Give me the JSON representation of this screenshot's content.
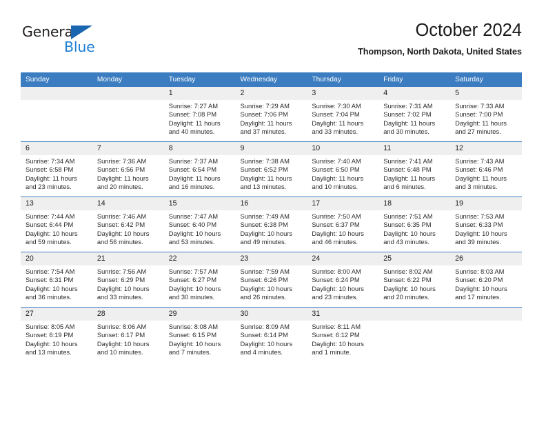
{
  "brand": {
    "name_top": "General",
    "name_bottom": "Blue",
    "accent_color": "#1f7fd4",
    "triangle_color": "#1b66b0"
  },
  "header": {
    "title": "October 2024",
    "location": "Thompson, North Dakota, United States"
  },
  "theme": {
    "header_row_bg": "#3b7dc0",
    "daynum_bg": "#efefef",
    "rule_color": "#3b7dc0",
    "text_color": "#2b2b2b"
  },
  "calendar": {
    "weekday_headers": [
      "Sunday",
      "Monday",
      "Tuesday",
      "Wednesday",
      "Thursday",
      "Friday",
      "Saturday"
    ],
    "labels": {
      "sunrise": "Sunrise:",
      "sunset": "Sunset:",
      "daylight": "Daylight:"
    },
    "weeks": [
      [
        {
          "day": "",
          "sunrise": "",
          "sunset": "",
          "daylight_1": "",
          "daylight_2": "",
          "empty": true
        },
        {
          "day": "",
          "sunrise": "",
          "sunset": "",
          "daylight_1": "",
          "daylight_2": "",
          "empty": true
        },
        {
          "day": "1",
          "sunrise": "Sunrise: 7:27 AM",
          "sunset": "Sunset: 7:08 PM",
          "daylight_1": "Daylight: 11 hours",
          "daylight_2": "and 40 minutes."
        },
        {
          "day": "2",
          "sunrise": "Sunrise: 7:29 AM",
          "sunset": "Sunset: 7:06 PM",
          "daylight_1": "Daylight: 11 hours",
          "daylight_2": "and 37 minutes."
        },
        {
          "day": "3",
          "sunrise": "Sunrise: 7:30 AM",
          "sunset": "Sunset: 7:04 PM",
          "daylight_1": "Daylight: 11 hours",
          "daylight_2": "and 33 minutes."
        },
        {
          "day": "4",
          "sunrise": "Sunrise: 7:31 AM",
          "sunset": "Sunset: 7:02 PM",
          "daylight_1": "Daylight: 11 hours",
          "daylight_2": "and 30 minutes."
        },
        {
          "day": "5",
          "sunrise": "Sunrise: 7:33 AM",
          "sunset": "Sunset: 7:00 PM",
          "daylight_1": "Daylight: 11 hours",
          "daylight_2": "and 27 minutes."
        }
      ],
      [
        {
          "day": "6",
          "sunrise": "Sunrise: 7:34 AM",
          "sunset": "Sunset: 6:58 PM",
          "daylight_1": "Daylight: 11 hours",
          "daylight_2": "and 23 minutes."
        },
        {
          "day": "7",
          "sunrise": "Sunrise: 7:36 AM",
          "sunset": "Sunset: 6:56 PM",
          "daylight_1": "Daylight: 11 hours",
          "daylight_2": "and 20 minutes."
        },
        {
          "day": "8",
          "sunrise": "Sunrise: 7:37 AM",
          "sunset": "Sunset: 6:54 PM",
          "daylight_1": "Daylight: 11 hours",
          "daylight_2": "and 16 minutes."
        },
        {
          "day": "9",
          "sunrise": "Sunrise: 7:38 AM",
          "sunset": "Sunset: 6:52 PM",
          "daylight_1": "Daylight: 11 hours",
          "daylight_2": "and 13 minutes."
        },
        {
          "day": "10",
          "sunrise": "Sunrise: 7:40 AM",
          "sunset": "Sunset: 6:50 PM",
          "daylight_1": "Daylight: 11 hours",
          "daylight_2": "and 10 minutes."
        },
        {
          "day": "11",
          "sunrise": "Sunrise: 7:41 AM",
          "sunset": "Sunset: 6:48 PM",
          "daylight_1": "Daylight: 11 hours",
          "daylight_2": "and 6 minutes."
        },
        {
          "day": "12",
          "sunrise": "Sunrise: 7:43 AM",
          "sunset": "Sunset: 6:46 PM",
          "daylight_1": "Daylight: 11 hours",
          "daylight_2": "and 3 minutes."
        }
      ],
      [
        {
          "day": "13",
          "sunrise": "Sunrise: 7:44 AM",
          "sunset": "Sunset: 6:44 PM",
          "daylight_1": "Daylight: 10 hours",
          "daylight_2": "and 59 minutes."
        },
        {
          "day": "14",
          "sunrise": "Sunrise: 7:46 AM",
          "sunset": "Sunset: 6:42 PM",
          "daylight_1": "Daylight: 10 hours",
          "daylight_2": "and 56 minutes."
        },
        {
          "day": "15",
          "sunrise": "Sunrise: 7:47 AM",
          "sunset": "Sunset: 6:40 PM",
          "daylight_1": "Daylight: 10 hours",
          "daylight_2": "and 53 minutes."
        },
        {
          "day": "16",
          "sunrise": "Sunrise: 7:49 AM",
          "sunset": "Sunset: 6:38 PM",
          "daylight_1": "Daylight: 10 hours",
          "daylight_2": "and 49 minutes."
        },
        {
          "day": "17",
          "sunrise": "Sunrise: 7:50 AM",
          "sunset": "Sunset: 6:37 PM",
          "daylight_1": "Daylight: 10 hours",
          "daylight_2": "and 46 minutes."
        },
        {
          "day": "18",
          "sunrise": "Sunrise: 7:51 AM",
          "sunset": "Sunset: 6:35 PM",
          "daylight_1": "Daylight: 10 hours",
          "daylight_2": "and 43 minutes."
        },
        {
          "day": "19",
          "sunrise": "Sunrise: 7:53 AM",
          "sunset": "Sunset: 6:33 PM",
          "daylight_1": "Daylight: 10 hours",
          "daylight_2": "and 39 minutes."
        }
      ],
      [
        {
          "day": "20",
          "sunrise": "Sunrise: 7:54 AM",
          "sunset": "Sunset: 6:31 PM",
          "daylight_1": "Daylight: 10 hours",
          "daylight_2": "and 36 minutes."
        },
        {
          "day": "21",
          "sunrise": "Sunrise: 7:56 AM",
          "sunset": "Sunset: 6:29 PM",
          "daylight_1": "Daylight: 10 hours",
          "daylight_2": "and 33 minutes."
        },
        {
          "day": "22",
          "sunrise": "Sunrise: 7:57 AM",
          "sunset": "Sunset: 6:27 PM",
          "daylight_1": "Daylight: 10 hours",
          "daylight_2": "and 30 minutes."
        },
        {
          "day": "23",
          "sunrise": "Sunrise: 7:59 AM",
          "sunset": "Sunset: 6:26 PM",
          "daylight_1": "Daylight: 10 hours",
          "daylight_2": "and 26 minutes."
        },
        {
          "day": "24",
          "sunrise": "Sunrise: 8:00 AM",
          "sunset": "Sunset: 6:24 PM",
          "daylight_1": "Daylight: 10 hours",
          "daylight_2": "and 23 minutes."
        },
        {
          "day": "25",
          "sunrise": "Sunrise: 8:02 AM",
          "sunset": "Sunset: 6:22 PM",
          "daylight_1": "Daylight: 10 hours",
          "daylight_2": "and 20 minutes."
        },
        {
          "day": "26",
          "sunrise": "Sunrise: 8:03 AM",
          "sunset": "Sunset: 6:20 PM",
          "daylight_1": "Daylight: 10 hours",
          "daylight_2": "and 17 minutes."
        }
      ],
      [
        {
          "day": "27",
          "sunrise": "Sunrise: 8:05 AM",
          "sunset": "Sunset: 6:19 PM",
          "daylight_1": "Daylight: 10 hours",
          "daylight_2": "and 13 minutes."
        },
        {
          "day": "28",
          "sunrise": "Sunrise: 8:06 AM",
          "sunset": "Sunset: 6:17 PM",
          "daylight_1": "Daylight: 10 hours",
          "daylight_2": "and 10 minutes."
        },
        {
          "day": "29",
          "sunrise": "Sunrise: 8:08 AM",
          "sunset": "Sunset: 6:15 PM",
          "daylight_1": "Daylight: 10 hours",
          "daylight_2": "and 7 minutes."
        },
        {
          "day": "30",
          "sunrise": "Sunrise: 8:09 AM",
          "sunset": "Sunset: 6:14 PM",
          "daylight_1": "Daylight: 10 hours",
          "daylight_2": "and 4 minutes."
        },
        {
          "day": "31",
          "sunrise": "Sunrise: 8:11 AM",
          "sunset": "Sunset: 6:12 PM",
          "daylight_1": "Daylight: 10 hours",
          "daylight_2": "and 1 minute."
        },
        {
          "day": "",
          "sunrise": "",
          "sunset": "",
          "daylight_1": "",
          "daylight_2": "",
          "empty": true
        },
        {
          "day": "",
          "sunrise": "",
          "sunset": "",
          "daylight_1": "",
          "daylight_2": "",
          "empty": true
        }
      ]
    ]
  }
}
